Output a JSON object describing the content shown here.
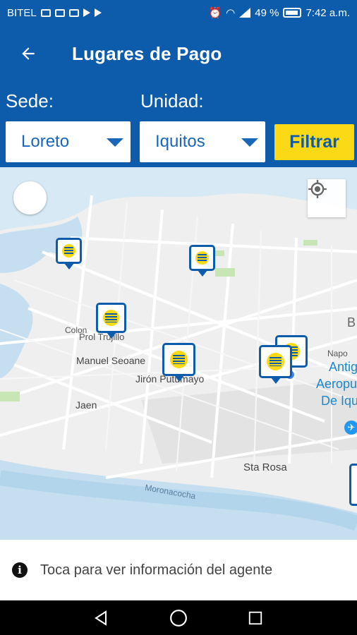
{
  "status_bar": {
    "carrier": "BITEL",
    "battery": "49 %",
    "time": "7:42 a.m."
  },
  "app_bar": {
    "title": "Lugares de Pago",
    "back_icon": "arrow-left-icon"
  },
  "filters": {
    "sede_label": "Sede:",
    "sede_value": "Loreto",
    "unidad_label": "Unidad:",
    "unidad_value": "Iquitos",
    "filter_button": "Filtrar"
  },
  "map": {
    "labels": [
      "Prol Trujillo",
      "Manuel Seoane",
      "Jirón Putumayo",
      "Jaen",
      "Sta Rosa",
      "Moronacocha",
      "Napo",
      "Colon",
      "Antiguo",
      "Aeropuerto",
      "De Iquitos",
      "B"
    ],
    "agent_pin_count": 6
  },
  "info": {
    "text": "Toca para ver información del agente"
  },
  "colors": {
    "primary": "#0d5cab",
    "accent": "#fcd915"
  }
}
